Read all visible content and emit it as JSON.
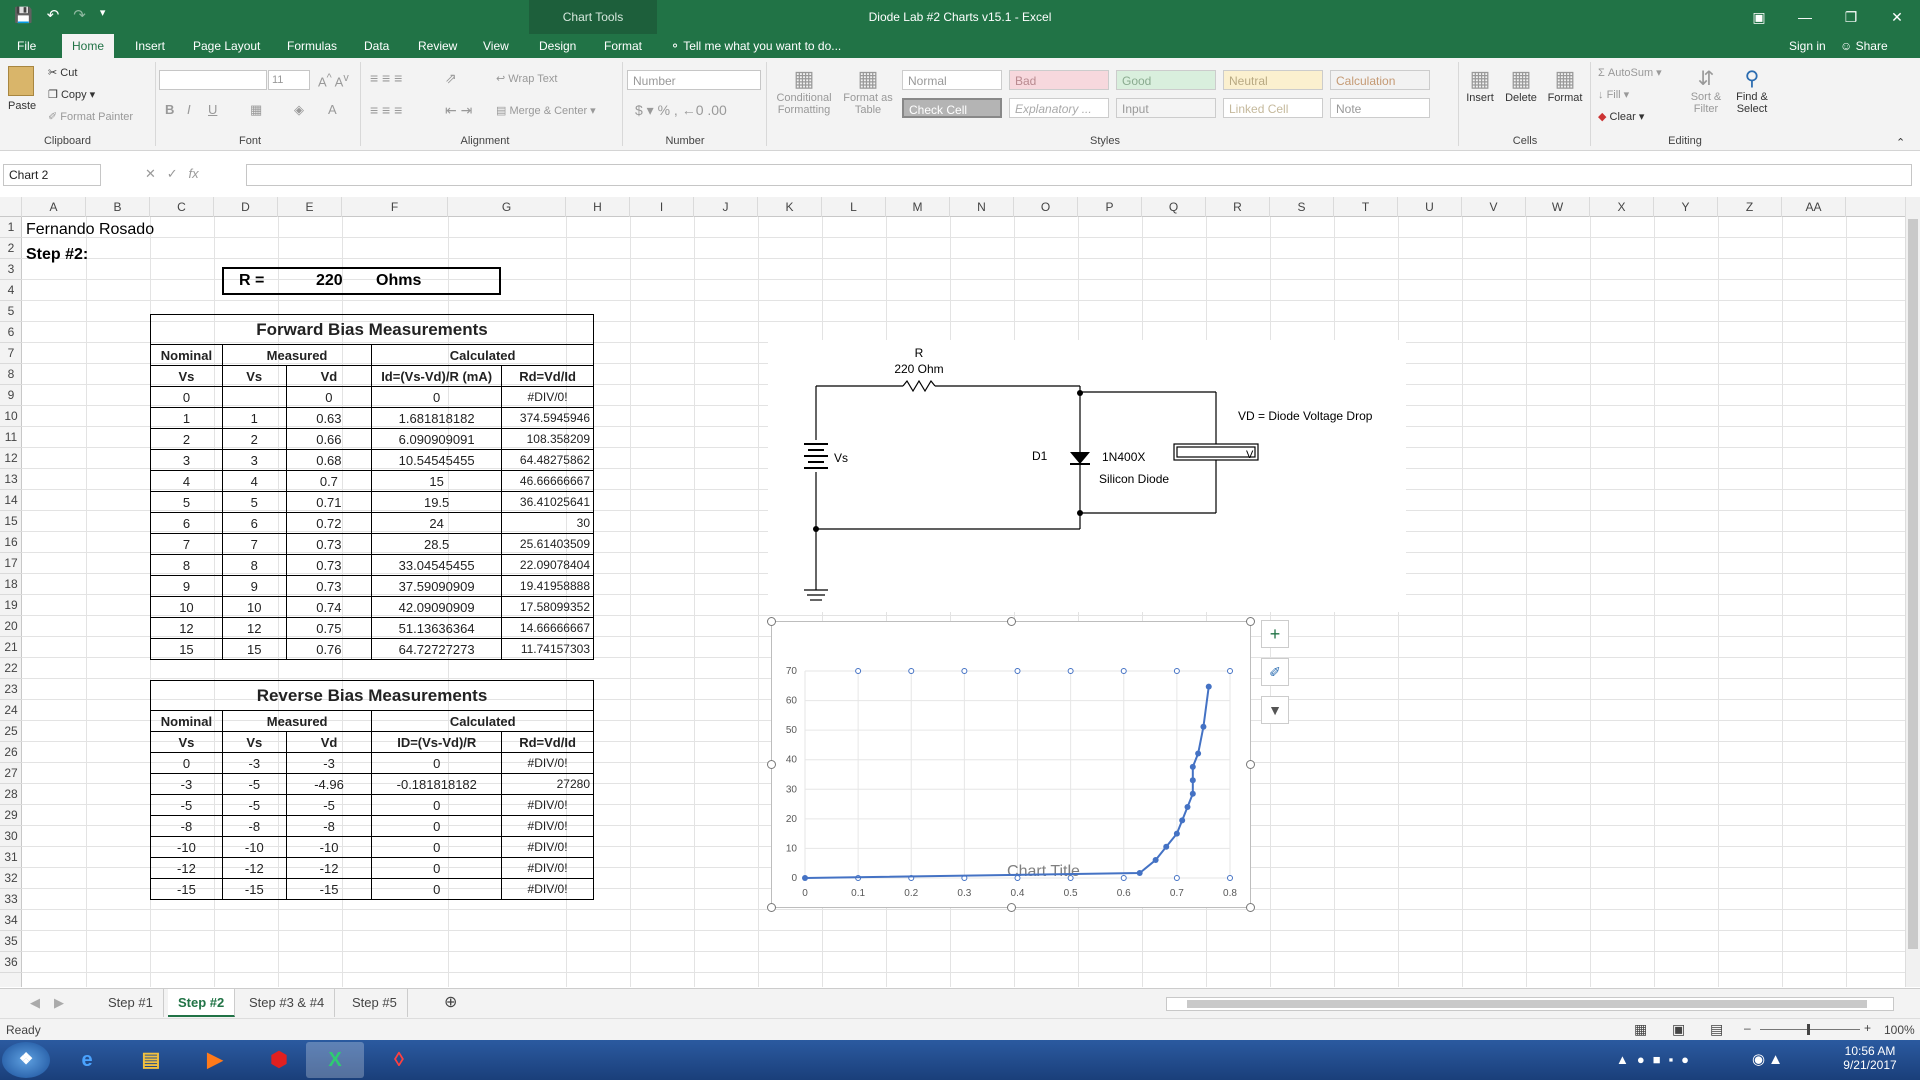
{
  "titlebar": {
    "title": "Diode Lab #2 Charts v15.1 - Excel",
    "context_tools": "Chart Tools"
  },
  "tabs": [
    "File",
    "Home",
    "Insert",
    "Page Layout",
    "Formulas",
    "Data",
    "Review",
    "View",
    "Design",
    "Format"
  ],
  "tell_me": "Tell me what you want to do...",
  "sign_in": "Sign in",
  "share": "Share",
  "ribbon": {
    "paste": "Paste",
    "cut": "Cut",
    "copy": "Copy",
    "format_painter": "Format Painter",
    "font_size": "11",
    "wrap_text": "Wrap Text",
    "merge_center": "Merge & Center",
    "number_format": "Number",
    "conditional_formatting": "Conditional Formatting",
    "format_as_table": "Format as Table",
    "styles": [
      "Normal",
      "Bad",
      "Good",
      "Neutral",
      "Calculation",
      "Check Cell",
      "Explanatory ...",
      "Input",
      "Linked Cell",
      "Note"
    ],
    "insert": "Insert",
    "delete": "Delete",
    "format": "Format",
    "autosum": "AutoSum",
    "fill": "Fill",
    "clear": "Clear",
    "sort_filter": "Sort & Filter",
    "find_select": "Find & Select",
    "groups": [
      "Clipboard",
      "Font",
      "Alignment",
      "Number",
      "Styles",
      "Cells",
      "Editing"
    ]
  },
  "namebox": "Chart 2",
  "fx_label": "fx",
  "columns": [
    "A",
    "B",
    "C",
    "D",
    "E",
    "F",
    "G",
    "H",
    "I",
    "J",
    "K",
    "L",
    "M",
    "N",
    "O",
    "P",
    "Q",
    "R",
    "S",
    "T",
    "U",
    "V",
    "W",
    "X",
    "Y",
    "Z",
    "AA"
  ],
  "rows": [
    "1",
    "2",
    "3",
    "4",
    "5",
    "6",
    "7",
    "8",
    "9",
    "10",
    "11",
    "12",
    "13",
    "14",
    "15",
    "16",
    "17",
    "18",
    "19",
    "20",
    "21",
    "22",
    "23",
    "24",
    "25",
    "26",
    "27",
    "28",
    "29",
    "30",
    "31",
    "32",
    "33",
    "34",
    "35",
    "36"
  ],
  "sheet": {
    "a1": "Fernando Rosado",
    "a2": "Step #2:",
    "r_label": "R  =",
    "r_value": "220",
    "r_unit": "Ohms"
  },
  "forward": {
    "title": "Forward Bias Measurements",
    "groups": [
      "Nominal",
      "Measured",
      "Calculated"
    ],
    "headers": [
      "Vs",
      "Vs",
      "Vd",
      "Id=(Vs-Vd)/R (mA)",
      "Rd=Vd/Id"
    ],
    "rows": [
      [
        "0",
        "",
        "0",
        "0",
        "#DIV/0!"
      ],
      [
        "1",
        "1",
        "0.63",
        "1.681818182",
        "374.5945946"
      ],
      [
        "2",
        "2",
        "0.66",
        "6.090909091",
        "108.358209"
      ],
      [
        "3",
        "3",
        "0.68",
        "10.54545455",
        "64.48275862"
      ],
      [
        "4",
        "4",
        "0.7",
        "15",
        "46.66666667"
      ],
      [
        "5",
        "5",
        "0.71",
        "19.5",
        "36.41025641"
      ],
      [
        "6",
        "6",
        "0.72",
        "24",
        "30"
      ],
      [
        "7",
        "7",
        "0.73",
        "28.5",
        "25.61403509"
      ],
      [
        "8",
        "8",
        "0.73",
        "33.04545455",
        "22.09078404"
      ],
      [
        "9",
        "9",
        "0.73",
        "37.59090909",
        "19.41958888"
      ],
      [
        "10",
        "10",
        "0.74",
        "42.09090909",
        "17.58099352"
      ],
      [
        "12",
        "12",
        "0.75",
        "51.13636364",
        "14.66666667"
      ],
      [
        "15",
        "15",
        "0.76",
        "64.72727273",
        "11.74157303"
      ]
    ]
  },
  "reverse": {
    "title": "Reverse Bias Measurements",
    "groups": [
      "Nominal",
      "Measured",
      "Calculated"
    ],
    "headers": [
      "Vs",
      "Vs",
      "Vd",
      "ID=(Vs-Vd)/R",
      "Rd=Vd/Id"
    ],
    "rows": [
      [
        "0",
        "-3",
        "-3",
        "0",
        "#DIV/0!"
      ],
      [
        "-3",
        "-5",
        "-4.96",
        "-0.181818182",
        "27280"
      ],
      [
        "-5",
        "-5",
        "-5",
        "0",
        "#DIV/0!"
      ],
      [
        "-8",
        "-8",
        "-8",
        "0",
        "#DIV/0!"
      ],
      [
        "-10",
        "-10",
        "-10",
        "0",
        "#DIV/0!"
      ],
      [
        "-12",
        "-12",
        "-12",
        "0",
        "#DIV/0!"
      ],
      [
        "-15",
        "-15",
        "-15",
        "0",
        "#DIV/0!"
      ]
    ]
  },
  "diagram": {
    "r_label": "R",
    "r_value": "220  Ohm",
    "vs_label": "Vs",
    "d1_label": "D1",
    "diode_part": "1N400X",
    "diode_type": "Silicon Diode",
    "meter_label": "V",
    "note": "VD = Diode Voltage Drop"
  },
  "chart_data": {
    "type": "scatter",
    "title": "Chart Title",
    "xlim": [
      0,
      0.8
    ],
    "ylim": [
      0,
      70
    ],
    "x_ticks": [
      "0",
      "0.1",
      "0.2",
      "0.3",
      "0.4",
      "0.5",
      "0.6",
      "0.7",
      "0.8"
    ],
    "y_ticks": [
      "0",
      "10",
      "20",
      "30",
      "40",
      "50",
      "60",
      "70"
    ],
    "grid": true,
    "series": [
      {
        "color": "#4472c4",
        "x": [
          0,
          0.63,
          0.66,
          0.68,
          0.7,
          0.71,
          0.72,
          0.73,
          0.73,
          0.73,
          0.74,
          0.75,
          0.76
        ],
        "y": [
          0,
          1.68,
          6.09,
          10.55,
          15,
          19.5,
          24,
          28.5,
          33.05,
          37.59,
          42.09,
          51.14,
          64.73
        ]
      }
    ]
  },
  "sheet_tabs": [
    "Step #1",
    "Step #2",
    "Step #3 & #4",
    "Step #5"
  ],
  "status": {
    "ready": "Ready",
    "zoom": "100%"
  },
  "clock": {
    "time": "10:56 AM",
    "date": "9/21/2017"
  }
}
